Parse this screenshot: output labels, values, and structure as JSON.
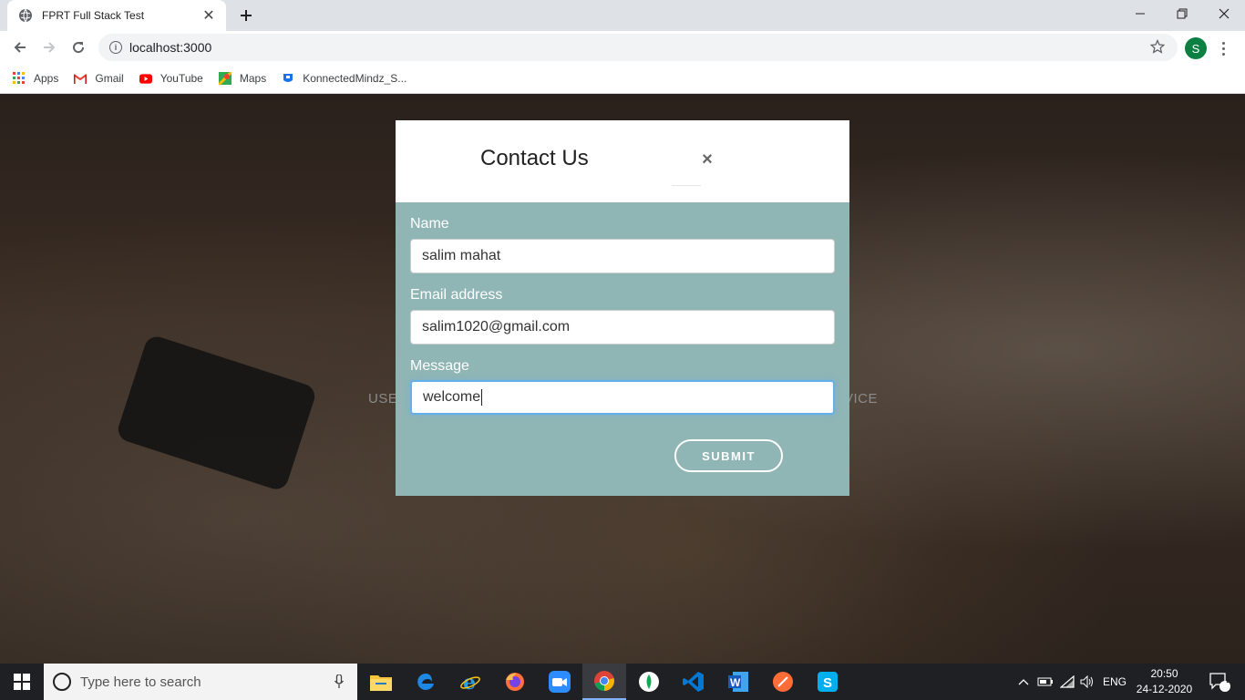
{
  "browser": {
    "tab_title": "FPRT Full Stack Test",
    "url": "localhost:3000",
    "profile_initial": "S",
    "bookmarks": [
      {
        "label": "Apps",
        "icon": "apps-grid-icon"
      },
      {
        "label": "Gmail",
        "icon": "gmail-icon"
      },
      {
        "label": "YouTube",
        "icon": "youtube-icon"
      },
      {
        "label": "Maps",
        "icon": "maps-icon"
      },
      {
        "label": "KonnectedMindz_S...",
        "icon": "bookmark-site-icon"
      }
    ]
  },
  "page": {
    "background_text_left": "USE",
    "background_text_right": "VICE"
  },
  "modal": {
    "title": "Contact Us",
    "close_symbol": "×",
    "fields": {
      "name": {
        "label": "Name",
        "value": "salim mahat"
      },
      "email": {
        "label": "Email address",
        "value": "salim1020@gmail.com"
      },
      "message": {
        "label": "Message",
        "value": "welcome"
      }
    },
    "submit_label": "SUBMIT"
  },
  "taskbar": {
    "search_placeholder": "Type here to search",
    "language": "ENG",
    "time": "20:50",
    "date": "24-12-2020",
    "notification_count": "2"
  },
  "colors": {
    "modal_body": "#8fb5b5",
    "taskbar": "#1f2024",
    "focus_ring": "#66afe9"
  }
}
